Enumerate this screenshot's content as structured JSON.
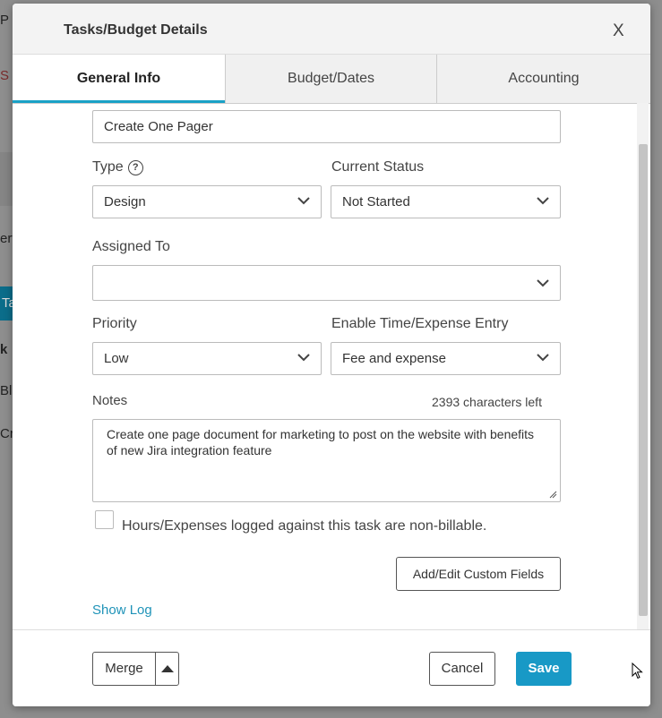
{
  "modal": {
    "title": "Tasks/Budget Details",
    "close_label": "X"
  },
  "tabs": [
    {
      "label": "General Info",
      "active": true
    },
    {
      "label": "Budget/Dates",
      "active": false
    },
    {
      "label": "Accounting",
      "active": false
    }
  ],
  "form": {
    "task_name": "Create One Pager",
    "type_label": "Type",
    "type_value": "Design",
    "status_label": "Current Status",
    "status_value": "Not Started",
    "assigned_label": "Assigned To",
    "assigned_value": "",
    "priority_label": "Priority",
    "priority_value": "Low",
    "entry_label": "Enable Time/Expense Entry",
    "entry_value": "Fee and expense",
    "notes_label": "Notes",
    "chars_left": "2393 characters left",
    "notes_value": "Create one page document for marketing to post on the website with benefits of new Jira integration feature",
    "nonbillable_label": "Hours/Expenses logged against this task are non-billable.",
    "nonbillable_checked": false,
    "custom_fields_label": "Add/Edit Custom Fields",
    "show_log_label": "Show Log"
  },
  "footer": {
    "merge_label": "Merge",
    "cancel_label": "Cancel",
    "save_label": "Save"
  },
  "background": {
    "frag1": "P",
    "frag2": "S",
    "frag3": "erv",
    "frag4": "Ta",
    "frag5": "k",
    "frag6": "Bl",
    "frag7": "Cr"
  },
  "colors": {
    "accent": "#1aa1c6",
    "save_button": "#1899c6",
    "link": "#1f93b8"
  }
}
